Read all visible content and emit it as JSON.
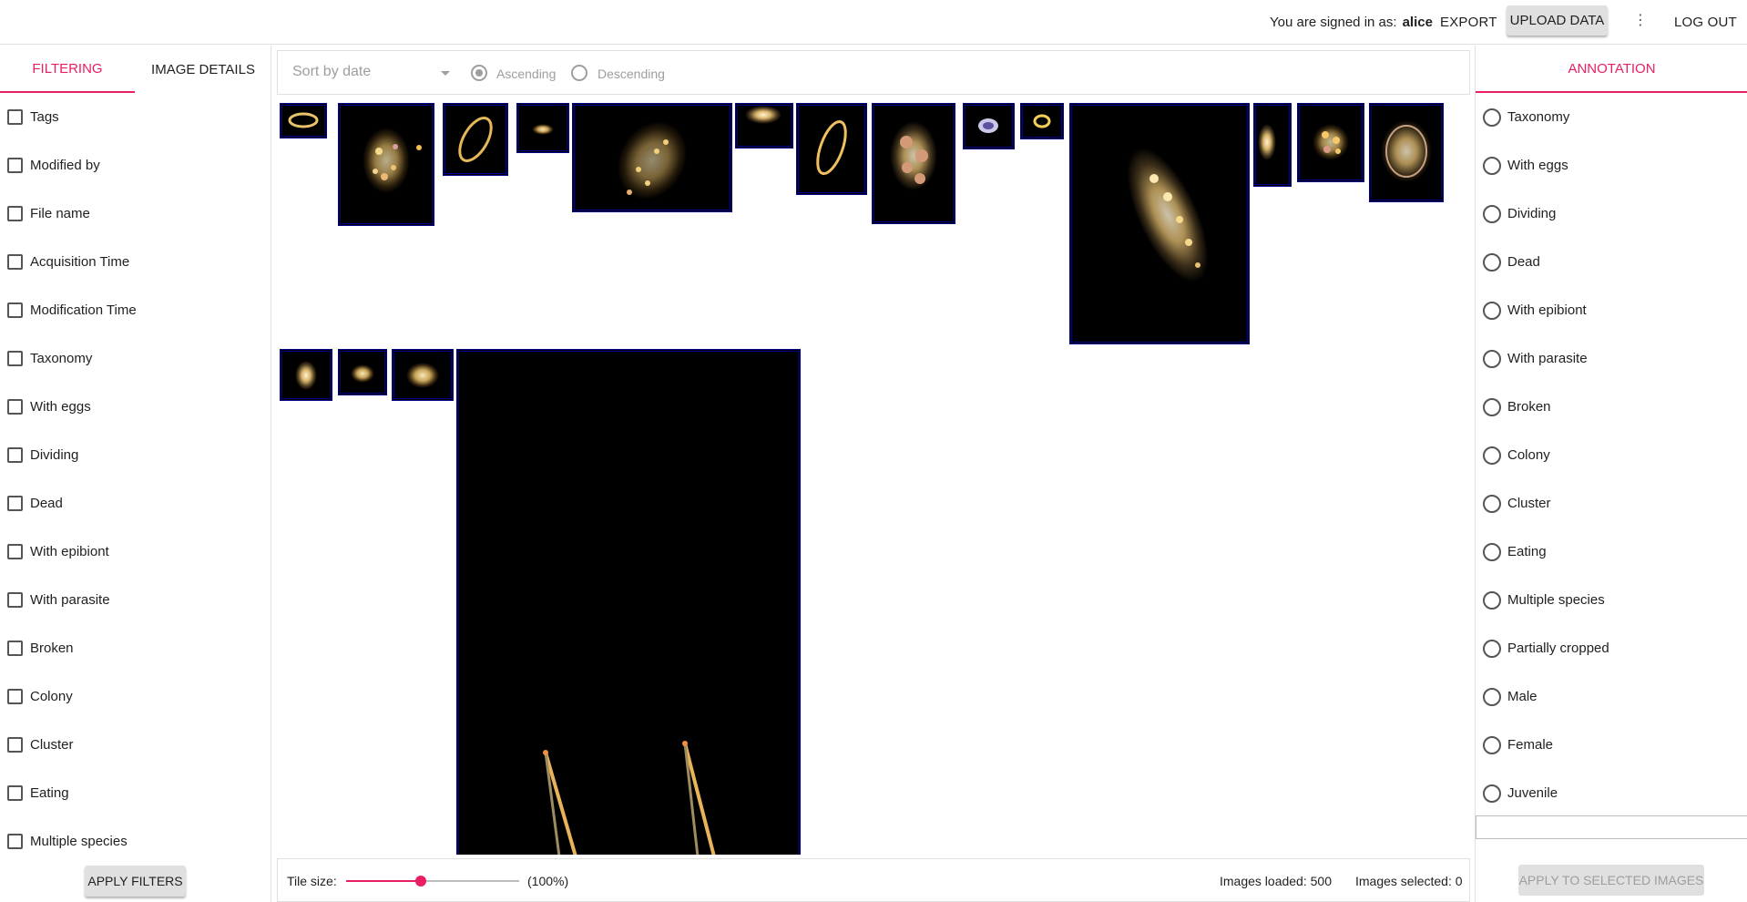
{
  "header": {
    "signed_in_label": "You are signed in as:",
    "username": "alice",
    "export_label": "EXPORT",
    "upload_label": "UPLOAD DATA",
    "menu_icon": "more-vert-icon",
    "logout_label": "LOG OUT"
  },
  "left_panel": {
    "tabs": [
      {
        "label": "FILTERING",
        "active": true
      },
      {
        "label": "IMAGE DETAILS",
        "active": false
      }
    ],
    "filters": [
      "Tags",
      "Modified by",
      "File name",
      "Acquisition Time",
      "Modification Time",
      "Taxonomy",
      "With eggs",
      "Dividing",
      "Dead",
      "With epibiont",
      "With parasite",
      "Broken",
      "Colony",
      "Cluster",
      "Eating",
      "Multiple species"
    ],
    "apply_label": "APPLY FILTERS"
  },
  "sort_bar": {
    "sort_placeholder": "Sort by date",
    "ascending_label": "Ascending",
    "descending_label": "Descending",
    "selected_order": "Ascending"
  },
  "gallery": {
    "tile_count": 19
  },
  "status_bar": {
    "tile_size_label": "Tile size:",
    "tile_size_value": 0.43,
    "tile_size_percent": "(100%)",
    "images_loaded": "Images loaded: 500",
    "images_selected": "Images selected: 0"
  },
  "right_panel": {
    "tab_label": "ANNOTATION",
    "options": [
      "Taxonomy",
      "With eggs",
      "Dividing",
      "Dead",
      "With epibiont",
      "With parasite",
      "Broken",
      "Colony",
      "Cluster",
      "Eating",
      "Multiple species",
      "Partially cropped",
      "Male",
      "Female",
      "Juvenile"
    ],
    "apply_label": "APPLY TO SELECTED IMAGES"
  },
  "colors": {
    "accent": "#e91e63",
    "tile_border": "#00008b",
    "disabled": "#9e9e9e"
  }
}
